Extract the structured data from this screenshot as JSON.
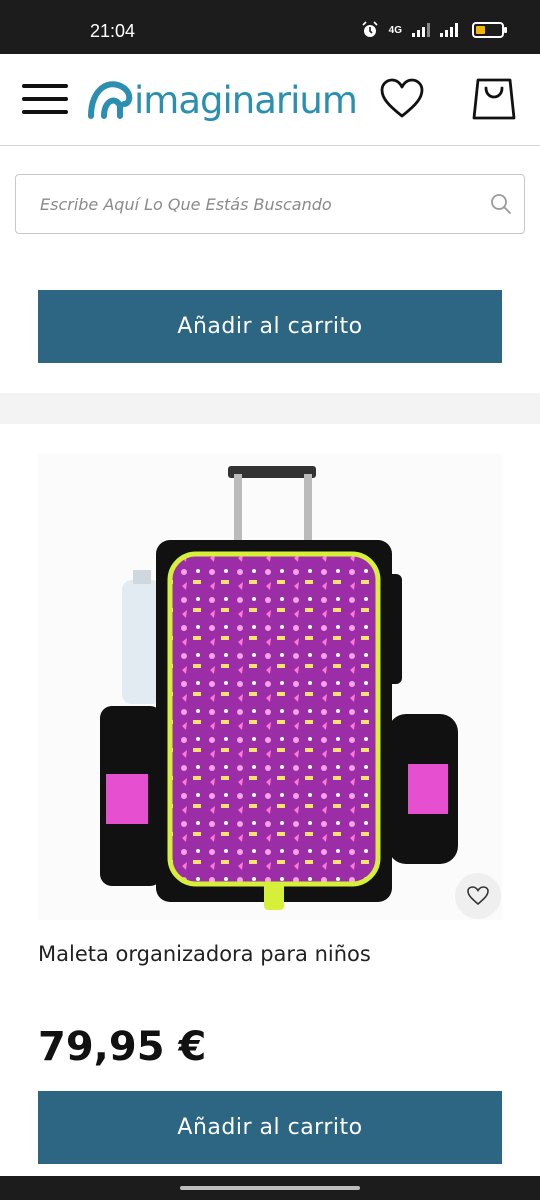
{
  "status_bar": {
    "time": "21:04",
    "network": "4G",
    "icons": [
      "alarm-icon",
      "signal-icon",
      "signal-icon",
      "battery-icon"
    ],
    "battery_level": 0.35,
    "battery_color": "#f2b705"
  },
  "header": {
    "brand": "imaginarium",
    "brand_color": "#2a8fb0",
    "menu_icon": "hamburger-icon",
    "wishlist_icon": "heart-icon",
    "cart_icon": "shopping-bag-icon"
  },
  "search": {
    "placeholder": "Escribe Aquí Lo Que Estás Buscando",
    "value": "",
    "icon": "search-icon"
  },
  "products": [
    {
      "add_to_cart_label": "Añadir al carrito"
    },
    {
      "name": "Maleta organizadora para niños",
      "price": "79,95 €",
      "add_to_cart_label": "Añadir al carrito",
      "wishlist_icon": "heart-icon"
    }
  ],
  "colors": {
    "button": "#2c6683",
    "brand": "#2a8fb0"
  }
}
